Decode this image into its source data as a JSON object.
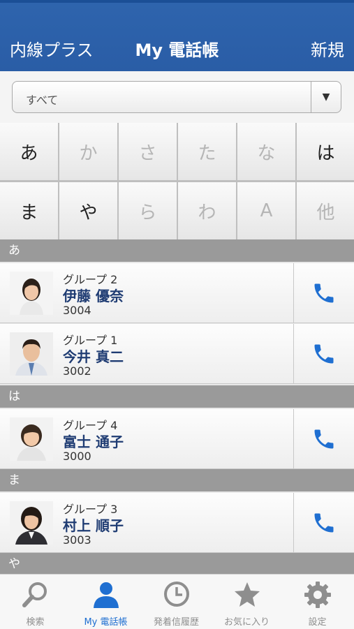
{
  "navbar": {
    "left": "内線プラス",
    "title": "My 電話帳",
    "right": "新規"
  },
  "filter": {
    "value": "すべて",
    "arrow": "▼"
  },
  "kana_keys": [
    {
      "label": "あ",
      "enabled": true
    },
    {
      "label": "か",
      "enabled": false
    },
    {
      "label": "さ",
      "enabled": false
    },
    {
      "label": "た",
      "enabled": false
    },
    {
      "label": "な",
      "enabled": false
    },
    {
      "label": "は",
      "enabled": true
    },
    {
      "label": "ま",
      "enabled": true
    },
    {
      "label": "や",
      "enabled": true
    },
    {
      "label": "ら",
      "enabled": false
    },
    {
      "label": "わ",
      "enabled": false
    },
    {
      "label": "A",
      "enabled": false
    },
    {
      "label": "他",
      "enabled": false
    }
  ],
  "sections": [
    {
      "header": "あ",
      "contacts": [
        {
          "group": "グループ 2",
          "name": "伊藤 優奈",
          "ext": "3004"
        },
        {
          "group": "グループ 1",
          "name": "今井 真二",
          "ext": "3002"
        }
      ]
    },
    {
      "header": "は",
      "contacts": [
        {
          "group": "グループ 4",
          "name": "富士 通子",
          "ext": "3000"
        }
      ]
    },
    {
      "header": "ま",
      "contacts": [
        {
          "group": "グループ 3",
          "name": "村上 順子",
          "ext": "3003"
        }
      ]
    },
    {
      "header": "や",
      "contacts": []
    }
  ],
  "tabs": [
    {
      "label": "検索",
      "icon": "search-icon",
      "active": false
    },
    {
      "label": "My 電話帳",
      "icon": "person-icon",
      "active": true
    },
    {
      "label": "発着信履歴",
      "icon": "clock-icon",
      "active": false
    },
    {
      "label": "お気に入り",
      "icon": "star-icon",
      "active": false
    },
    {
      "label": "設定",
      "icon": "gear-icon",
      "active": false
    }
  ],
  "colors": {
    "navbar": "#2a5da6",
    "accent": "#1f6fd1",
    "section": "#9a9a9a",
    "name": "#1f3c73"
  }
}
